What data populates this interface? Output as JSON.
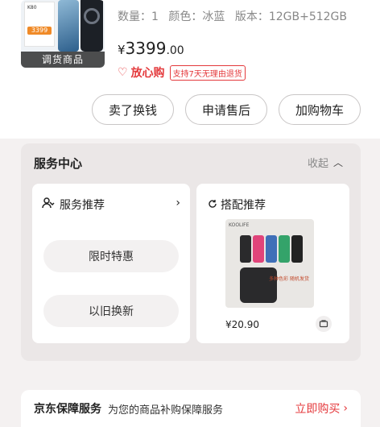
{
  "product": {
    "thumb_label": "调货商品",
    "promo_brand": "K80",
    "promo_price": "3399",
    "spec": {
      "quantity": "数量：1",
      "color": "颜色：冰蓝",
      "version": "版本：12GB+512GB"
    },
    "price": {
      "currency": "¥",
      "integer": "3399",
      "decimal": ".00"
    },
    "assurance_text": "放心购",
    "assurance_badge": "支持7天无理由退货"
  },
  "actions": {
    "sell": "卖了换钱",
    "after_sale": "申请售后",
    "add_cart": "加购物车"
  },
  "service_center": {
    "title": "服务中心",
    "collapse_label": "收起",
    "recommend": {
      "title": "服务推荐",
      "items": [
        "限时特惠",
        "以旧换新"
      ]
    },
    "bundle": {
      "title": "搭配推荐",
      "product_brand": "KOOLIFE",
      "product_note": "多种色彩 随机发货",
      "price_symbol": "¥",
      "price_value": "20.90"
    }
  },
  "jd_protect": {
    "title": "京东保障服务",
    "desc": "为您的商品补购保障服务",
    "buy": "立即购买"
  },
  "colors": {
    "accent": "#e4393c",
    "badge_orange": "#f08a27"
  },
  "icons": [
    "heart-icon",
    "chevron-up-icon",
    "service-person-icon",
    "chevron-right-icon",
    "bundle-refresh-icon",
    "cart-icon"
  ]
}
